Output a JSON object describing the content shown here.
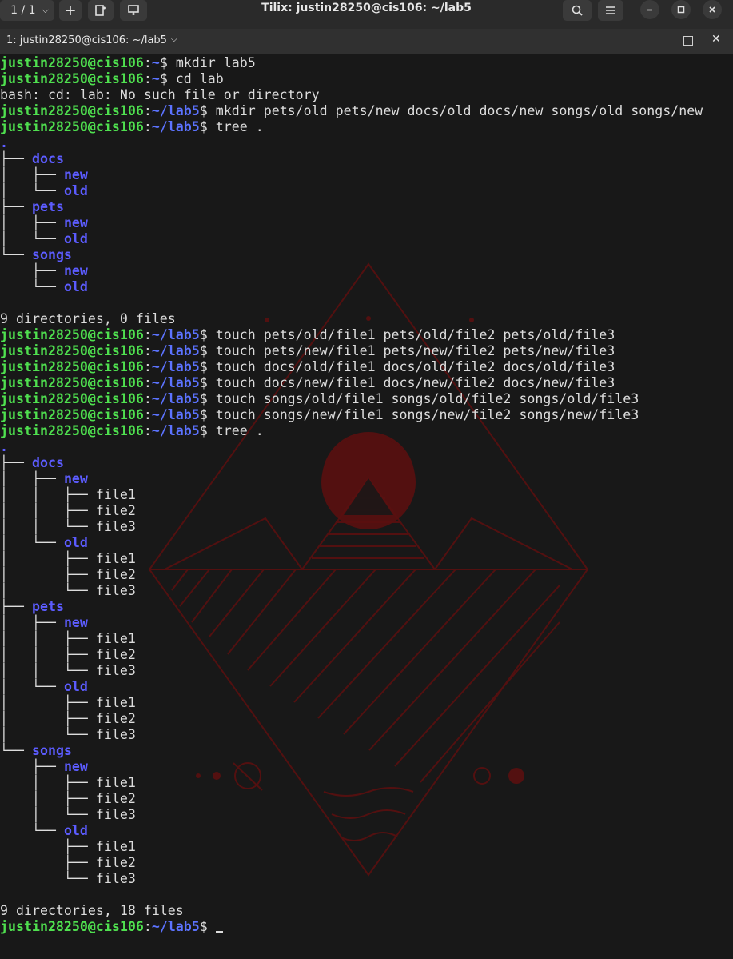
{
  "window": {
    "title": "Tilix: justin28250@cis106: ~/lab5",
    "session_selector": "1 / 1",
    "tab_label": "1: justin28250@cis106: ~/lab5"
  },
  "icons": {
    "session": "chevron-down-icon",
    "add": "plus-icon",
    "split_right": "split-right-icon",
    "split_down": "split-down-icon",
    "search": "search-icon",
    "menu": "hamburger-menu-icon",
    "minimize": "minimize-icon",
    "maximize": "maximize-icon",
    "close": "close-icon"
  },
  "colors": {
    "prompt_user": "#4fe04f",
    "prompt_path": "#5c73ff",
    "directory": "#5c5cff",
    "text": "#dcdcdc",
    "wallpaper": "#5a1010"
  },
  "terminal": {
    "prompt_user": "justin28250@cis106",
    "lines": [
      {
        "kind": "prompt",
        "path": "~",
        "cmd": "mkdir lab5"
      },
      {
        "kind": "prompt",
        "path": "~",
        "cmd": "cd lab"
      },
      {
        "kind": "text",
        "text": "bash: cd: lab: No such file or directory"
      },
      {
        "kind": "prompt",
        "path": "~/lab5",
        "cmd": "mkdir pets/old pets/new docs/old docs/new songs/old songs/new"
      },
      {
        "kind": "prompt",
        "path": "~/lab5",
        "cmd": "tree ."
      },
      {
        "kind": "tree",
        "prefix": "",
        "name": ".",
        "dir": true
      },
      {
        "kind": "tree",
        "prefix": "├── ",
        "name": "docs",
        "dir": true
      },
      {
        "kind": "tree",
        "prefix": "│   ├── ",
        "name": "new",
        "dir": true
      },
      {
        "kind": "tree",
        "prefix": "│   └── ",
        "name": "old",
        "dir": true
      },
      {
        "kind": "tree",
        "prefix": "├── ",
        "name": "pets",
        "dir": true
      },
      {
        "kind": "tree",
        "prefix": "│   ├── ",
        "name": "new",
        "dir": true
      },
      {
        "kind": "tree",
        "prefix": "│   └── ",
        "name": "old",
        "dir": true
      },
      {
        "kind": "tree",
        "prefix": "└── ",
        "name": "songs",
        "dir": true
      },
      {
        "kind": "tree",
        "prefix": "    ├── ",
        "name": "new",
        "dir": true
      },
      {
        "kind": "tree",
        "prefix": "    └── ",
        "name": "old",
        "dir": true
      },
      {
        "kind": "text",
        "text": ""
      },
      {
        "kind": "text",
        "text": "9 directories, 0 files"
      },
      {
        "kind": "prompt",
        "path": "~/lab5",
        "cmd": "touch pets/old/file1 pets/old/file2 pets/old/file3"
      },
      {
        "kind": "prompt",
        "path": "~/lab5",
        "cmd": "touch pets/new/file1 pets/new/file2 pets/new/file3"
      },
      {
        "kind": "prompt",
        "path": "~/lab5",
        "cmd": "touch docs/old/file1 docs/old/file2 docs/old/file3"
      },
      {
        "kind": "prompt",
        "path": "~/lab5",
        "cmd": "touch docs/new/file1 docs/new/file2 docs/new/file3"
      },
      {
        "kind": "prompt",
        "path": "~/lab5",
        "cmd": "touch songs/old/file1 songs/old/file2 songs/old/file3"
      },
      {
        "kind": "prompt",
        "path": "~/lab5",
        "cmd": "touch songs/new/file1 songs/new/file2 songs/new/file3"
      },
      {
        "kind": "prompt",
        "path": "~/lab5",
        "cmd": "tree ."
      },
      {
        "kind": "tree",
        "prefix": "",
        "name": ".",
        "dir": true
      },
      {
        "kind": "tree",
        "prefix": "├── ",
        "name": "docs",
        "dir": true
      },
      {
        "kind": "tree",
        "prefix": "│   ├── ",
        "name": "new",
        "dir": true
      },
      {
        "kind": "tree",
        "prefix": "│   │   ├── ",
        "name": "file1",
        "dir": false
      },
      {
        "kind": "tree",
        "prefix": "│   │   ├── ",
        "name": "file2",
        "dir": false
      },
      {
        "kind": "tree",
        "prefix": "│   │   └── ",
        "name": "file3",
        "dir": false
      },
      {
        "kind": "tree",
        "prefix": "│   └── ",
        "name": "old",
        "dir": true
      },
      {
        "kind": "tree",
        "prefix": "│       ├── ",
        "name": "file1",
        "dir": false
      },
      {
        "kind": "tree",
        "prefix": "│       ├── ",
        "name": "file2",
        "dir": false
      },
      {
        "kind": "tree",
        "prefix": "│       └── ",
        "name": "file3",
        "dir": false
      },
      {
        "kind": "tree",
        "prefix": "├── ",
        "name": "pets",
        "dir": true
      },
      {
        "kind": "tree",
        "prefix": "│   ├── ",
        "name": "new",
        "dir": true
      },
      {
        "kind": "tree",
        "prefix": "│   │   ├── ",
        "name": "file1",
        "dir": false
      },
      {
        "kind": "tree",
        "prefix": "│   │   ├── ",
        "name": "file2",
        "dir": false
      },
      {
        "kind": "tree",
        "prefix": "│   │   └── ",
        "name": "file3",
        "dir": false
      },
      {
        "kind": "tree",
        "prefix": "│   └── ",
        "name": "old",
        "dir": true
      },
      {
        "kind": "tree",
        "prefix": "│       ├── ",
        "name": "file1",
        "dir": false
      },
      {
        "kind": "tree",
        "prefix": "│       ├── ",
        "name": "file2",
        "dir": false
      },
      {
        "kind": "tree",
        "prefix": "│       └── ",
        "name": "file3",
        "dir": false
      },
      {
        "kind": "tree",
        "prefix": "└── ",
        "name": "songs",
        "dir": true
      },
      {
        "kind": "tree",
        "prefix": "    ├── ",
        "name": "new",
        "dir": true
      },
      {
        "kind": "tree",
        "prefix": "    │   ├── ",
        "name": "file1",
        "dir": false
      },
      {
        "kind": "tree",
        "prefix": "    │   ├── ",
        "name": "file2",
        "dir": false
      },
      {
        "kind": "tree",
        "prefix": "    │   └── ",
        "name": "file3",
        "dir": false
      },
      {
        "kind": "tree",
        "prefix": "    └── ",
        "name": "old",
        "dir": true
      },
      {
        "kind": "tree",
        "prefix": "        ├── ",
        "name": "file1",
        "dir": false
      },
      {
        "kind": "tree",
        "prefix": "        ├── ",
        "name": "file2",
        "dir": false
      },
      {
        "kind": "tree",
        "prefix": "        └── ",
        "name": "file3",
        "dir": false
      },
      {
        "kind": "text",
        "text": ""
      },
      {
        "kind": "text",
        "text": "9 directories, 18 files"
      },
      {
        "kind": "prompt",
        "path": "~/lab5",
        "cmd": "",
        "cursor": true
      }
    ]
  }
}
